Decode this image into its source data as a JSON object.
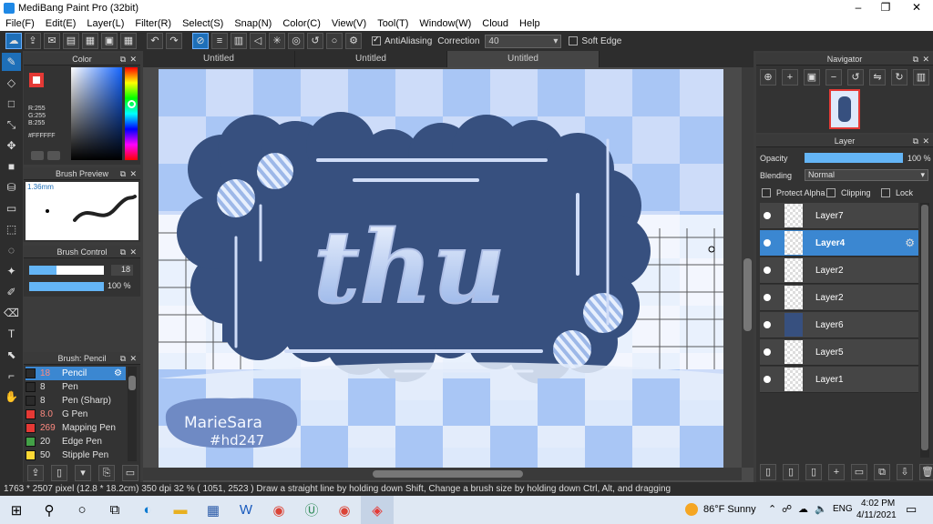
{
  "window": {
    "title": "MediBang Paint Pro (32bit)",
    "minimize": "–",
    "maximize": "❐",
    "close": "✕"
  },
  "menu": [
    "File(F)",
    "Edit(E)",
    "Layer(L)",
    "Filter(R)",
    "Select(S)",
    "Snap(N)",
    "Color(C)",
    "View(V)",
    "Tool(T)",
    "Window(W)",
    "Cloud",
    "Help"
  ],
  "toolbar": {
    "antialiasing": "AntiAliasing",
    "correction_label": "Correction",
    "correction_value": "40",
    "soft_edge": "Soft Edge"
  },
  "tabs": [
    "Untitled",
    "Untitled",
    "Untitled"
  ],
  "color_panel": {
    "title": "Color",
    "values": "R:255\nG:255\nB:255",
    "hex": "#FFFFFF"
  },
  "brush_preview": {
    "title": "Brush Preview",
    "size": "1.36mm"
  },
  "brush_control": {
    "title": "Brush Control",
    "size_value": "18",
    "opacity_value": "100 %"
  },
  "brush_list": {
    "title": "Brush: Pencil",
    "items": [
      {
        "size": "18",
        "name": "Pencil",
        "color": "#2b2b2b"
      },
      {
        "size": "8",
        "name": "Pen",
        "color": "#2b2b2b"
      },
      {
        "size": "8",
        "name": "Pen (Sharp)",
        "color": "#2b2b2b"
      },
      {
        "size": "8.0",
        "name": "G Pen",
        "color": "#e53935"
      },
      {
        "size": "269",
        "name": "Mapping Pen",
        "color": "#e53935"
      },
      {
        "size": "20",
        "name": "Edge Pen",
        "color": "#43a047"
      },
      {
        "size": "50",
        "name": "Stipple Pen",
        "color": "#fdd835"
      }
    ]
  },
  "artwork": {
    "main_text": "thu",
    "signature_line1": "MarieSara",
    "signature_line2": "#hd247"
  },
  "navigator": {
    "title": "Navigator"
  },
  "layer_panel": {
    "title": "Layer",
    "opacity_label": "Opacity",
    "opacity_value": "100 %",
    "blending_label": "Blending",
    "blending_value": "Normal",
    "protect_alpha": "Protect Alpha",
    "clipping": "Clipping",
    "lock": "Lock",
    "layers": [
      "Layer7",
      "Layer4",
      "Layer2",
      "Layer2",
      "Layer6",
      "Layer5",
      "Layer1"
    ]
  },
  "status": "1763 * 2507 pixel  (12.8 * 18.2cm)  350 dpi  32 %  ( 1051, 2523 )  Draw a straight line by holding down Shift, Change a brush size by holding down Ctrl, Alt, and dragging",
  "taskbar": {
    "weather": "86°F  Sunny",
    "lang": "ENG",
    "time": "4:02 PM",
    "date": "4/11/2021"
  }
}
